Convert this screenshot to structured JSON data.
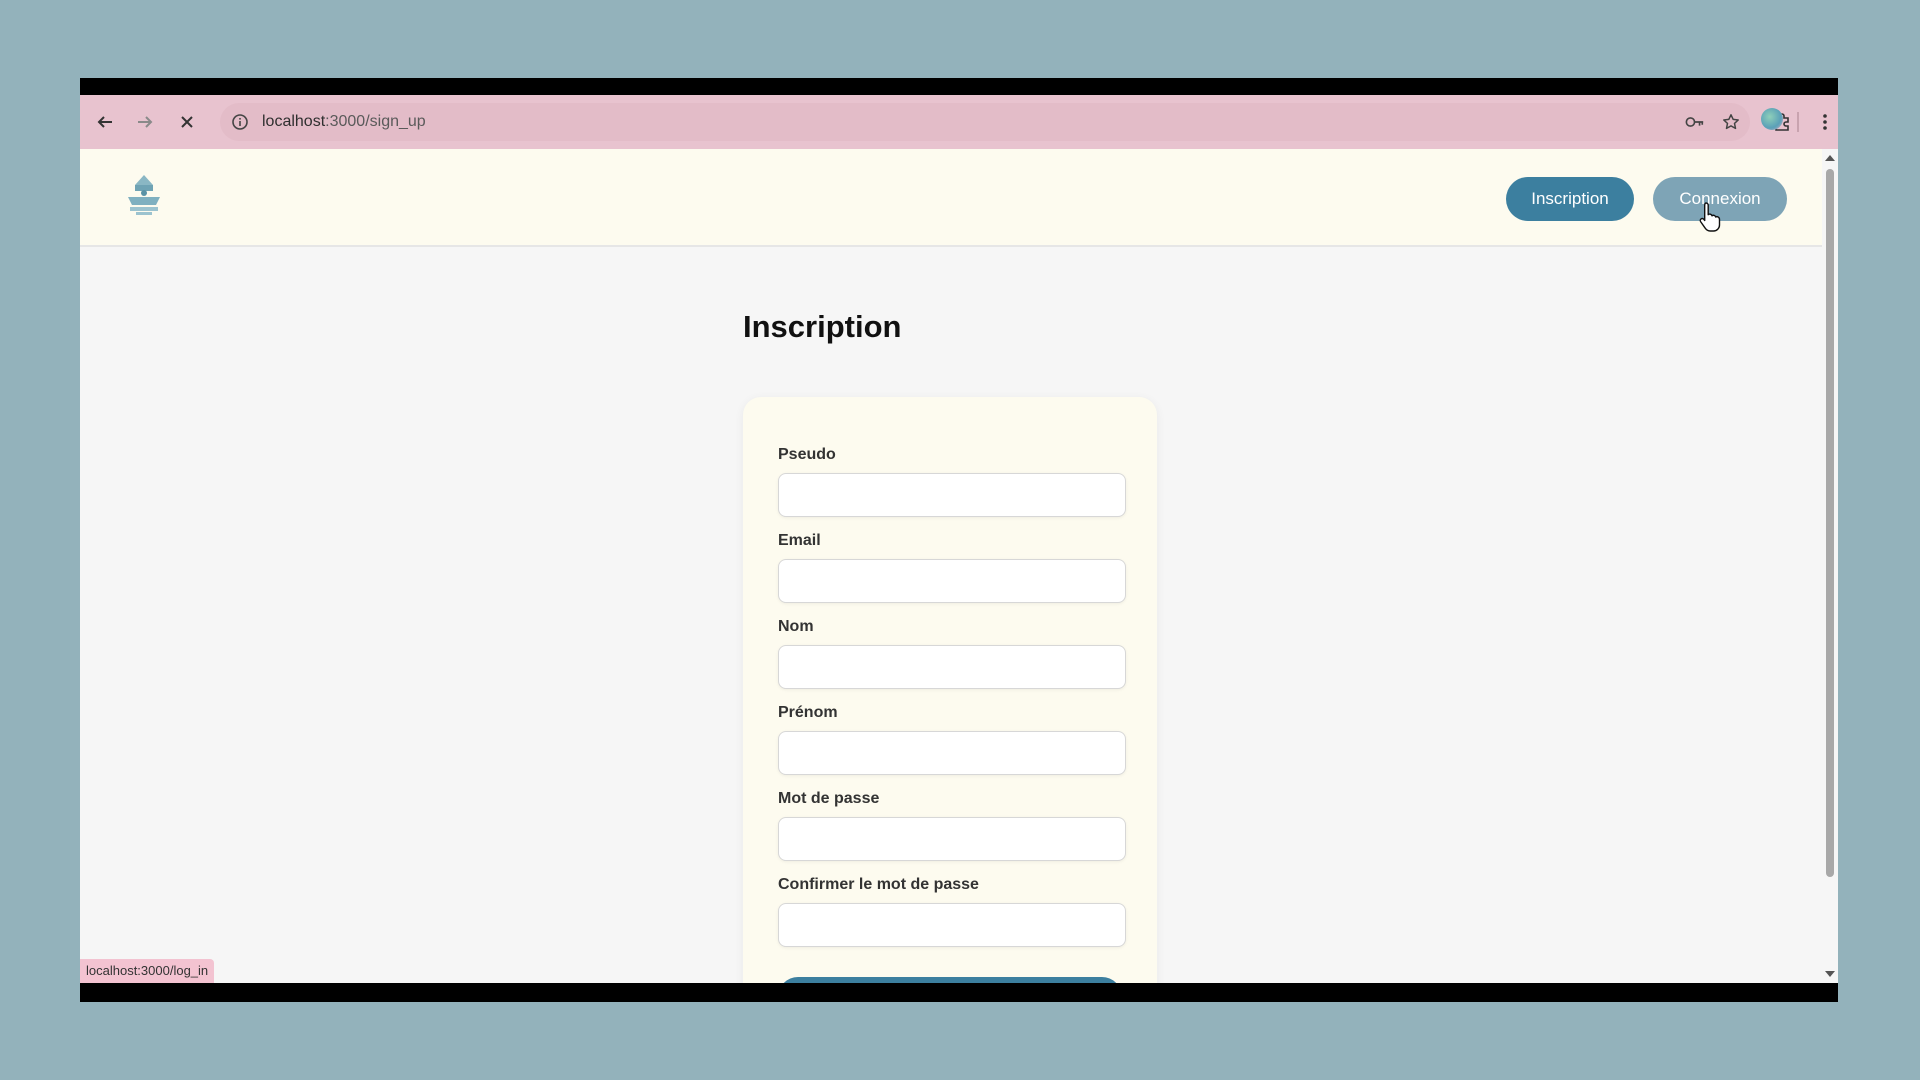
{
  "browser": {
    "url_host": "localhost",
    "url_path": ":3000/sign_up",
    "status_url": "localhost:3000/log_in",
    "icons": [
      "back-arrow-icon",
      "forward-arrow-icon",
      "close-icon",
      "info-icon",
      "key-icon",
      "star-icon",
      "extension-icon",
      "profile-icon",
      "kebab-menu-icon"
    ]
  },
  "navbar": {
    "signup_label": "Inscription",
    "login_label": "Connexion"
  },
  "page": {
    "title": "Inscription"
  },
  "form": {
    "fields": [
      {
        "label": "Pseudo",
        "value": ""
      },
      {
        "label": "Email",
        "value": ""
      },
      {
        "label": "Nom",
        "value": ""
      },
      {
        "label": "Prénom",
        "value": ""
      },
      {
        "label": "Mot de passe",
        "value": ""
      },
      {
        "label": "Confirmer le mot de passe",
        "value": ""
      }
    ]
  },
  "colors": {
    "primary": "#3c7f9f",
    "secondary": "#7ea4b6",
    "toolbar": "#e8c3cf",
    "card": "#fdfbef"
  }
}
